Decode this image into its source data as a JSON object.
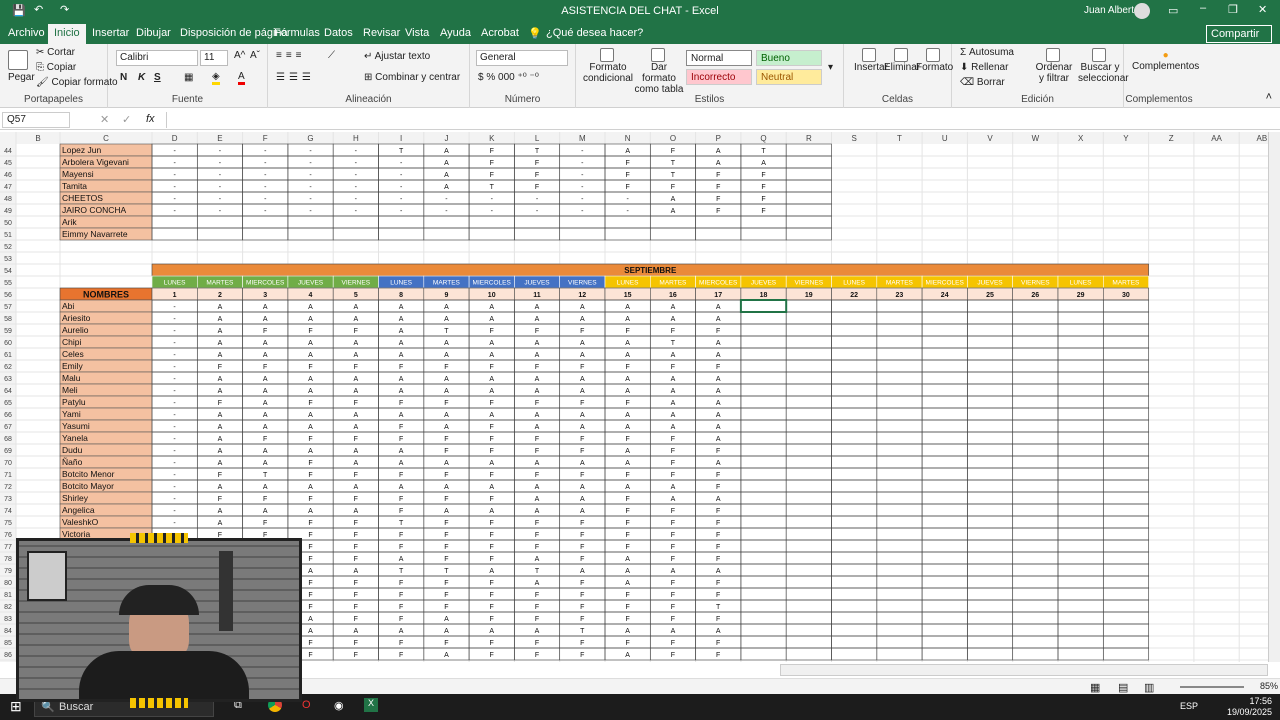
{
  "window": {
    "title": "ASISTENCIA DEL CHAT  -  Excel",
    "user": "Juan Alberto"
  },
  "menu_tabs": [
    "Archivo",
    "Inicio",
    "Insertar",
    "Dibujar",
    "Disposición de página",
    "Fórmulas",
    "Datos",
    "Revisar",
    "Vista",
    "Ayuda",
    "Acrobat"
  ],
  "tell_me": "¿Qué desea hacer?",
  "share_label": "Compartir",
  "ribbon": {
    "clipboard": {
      "paste": "Pegar",
      "cut": "Cortar",
      "copy": "Copiar",
      "format_painter": "Copiar formato",
      "label": "Portapapeles"
    },
    "font": {
      "name": "Calibri",
      "size": "11",
      "label": "Fuente",
      "bold": "N",
      "italic": "K",
      "underline": "S"
    },
    "alignment": {
      "wrap": "Ajustar texto",
      "merge": "Combinar y centrar",
      "label": "Alineación"
    },
    "number": {
      "format": "General",
      "label": "Número"
    },
    "styles": {
      "cond": "Formato condicional",
      "table": "Dar formato como tabla",
      "normal": "Normal",
      "good": "Bueno",
      "bad": "Incorrecto",
      "neutral": "Neutral",
      "label": "Estilos"
    },
    "cells": {
      "insert": "Insertar",
      "delete": "Eliminar",
      "format": "Formato",
      "label": "Celdas"
    },
    "editing": {
      "autosum": "Autosuma",
      "fill": "Rellenar",
      "clear": "Borrar",
      "sort": "Ordenar y filtrar",
      "find": "Buscar y seleccionar",
      "label": "Edición"
    },
    "addins": {
      "btn": "Complementos",
      "label": "Complementos"
    }
  },
  "namebox": "Q57",
  "columns": [
    "B",
    "C",
    "D",
    "E",
    "F",
    "G",
    "H",
    "I",
    "J",
    "K",
    "L",
    "M",
    "N",
    "O",
    "P",
    "Q",
    "R",
    "S",
    "T",
    "U",
    "V",
    "W",
    "X",
    "Y",
    "Z",
    "AA",
    "AB"
  ],
  "upper_rows": [
    {
      "row": "44",
      "name": "Lopez Jun",
      "vals": [
        "-",
        "-",
        "-",
        "-",
        "-",
        "T",
        "A",
        "F",
        "T",
        "-",
        "A",
        "F",
        "A",
        "T"
      ]
    },
    {
      "row": "45",
      "name": "Arbolera Vigevani",
      "vals": [
        "-",
        "-",
        "-",
        "-",
        "-",
        "-",
        "A",
        "F",
        "F",
        "-",
        "F",
        "T",
        "A",
        "A"
      ]
    },
    {
      "row": "46",
      "name": "Mayensi",
      "vals": [
        "-",
        "-",
        "-",
        "-",
        "-",
        "-",
        "A",
        "F",
        "F",
        "-",
        "F",
        "T",
        "F",
        "F"
      ]
    },
    {
      "row": "47",
      "name": "Tamita",
      "vals": [
        "-",
        "-",
        "-",
        "-",
        "-",
        "-",
        "A",
        "T",
        "F",
        "-",
        "F",
        "F",
        "F",
        "F"
      ]
    },
    {
      "row": "48",
      "name": "CHEETOS",
      "vals": [
        "-",
        "-",
        "-",
        "-",
        "-",
        "-",
        "-",
        "-",
        "-",
        "-",
        "-",
        "A",
        "F",
        "F"
      ]
    },
    {
      "row": "49",
      "name": "JAIRO CONCHA",
      "vals": [
        "-",
        "-",
        "-",
        "-",
        "-",
        "-",
        "-",
        "-",
        "-",
        "-",
        "-",
        "A",
        "F",
        "F"
      ]
    },
    {
      "row": "50",
      "name": "Arik",
      "vals": []
    },
    {
      "row": "51",
      "name": "Eimmy Navarrete",
      "vals": []
    }
  ],
  "month": "SEPTIEMBRE",
  "names_header": "NOMBRES",
  "weekdays": [
    "LUNES",
    "MARTES",
    "MIERCOLES",
    "JUEVES",
    "VIERNES",
    "LUNES",
    "MARTES",
    "MIERCOLES",
    "JUEVES",
    "VIERNES",
    "LUNES",
    "MARTES",
    "MIERCOLES",
    "JUEVES",
    "VIERNES",
    "LUNES",
    "MARTES",
    "MIERCOLES",
    "JUEVES",
    "VIERNES",
    "LUNES",
    "MARTES"
  ],
  "days": [
    "1",
    "2",
    "3",
    "4",
    "5",
    "8",
    "9",
    "10",
    "11",
    "12",
    "15",
    "16",
    "17",
    "18",
    "19",
    "22",
    "23",
    "24",
    "25",
    "26",
    "29",
    "30"
  ],
  "lower_rows": [
    {
      "row": "57",
      "name": "Abi",
      "vals": [
        "-",
        "A",
        "A",
        "A",
        "A",
        "A",
        "A",
        "A",
        "A",
        "A",
        "A",
        "A",
        "A"
      ]
    },
    {
      "row": "58",
      "name": "Ariesito",
      "vals": [
        "-",
        "A",
        "A",
        "A",
        "A",
        "A",
        "A",
        "A",
        "A",
        "A",
        "A",
        "A",
        "A"
      ]
    },
    {
      "row": "59",
      "name": "Aurelio",
      "vals": [
        "-",
        "A",
        "F",
        "F",
        "F",
        "A",
        "T",
        "F",
        "F",
        "F",
        "F",
        "F",
        "F"
      ]
    },
    {
      "row": "60",
      "name": "Chipi",
      "vals": [
        "-",
        "A",
        "A",
        "A",
        "A",
        "A",
        "A",
        "A",
        "A",
        "A",
        "A",
        "T",
        "A"
      ]
    },
    {
      "row": "61",
      "name": "Celes",
      "vals": [
        "-",
        "A",
        "A",
        "A",
        "A",
        "A",
        "A",
        "A",
        "A",
        "A",
        "A",
        "A",
        "A"
      ]
    },
    {
      "row": "62",
      "name": "Emily",
      "vals": [
        "-",
        "F",
        "F",
        "F",
        "F",
        "F",
        "F",
        "F",
        "F",
        "F",
        "F",
        "F",
        "F"
      ]
    },
    {
      "row": "63",
      "name": "Malu",
      "vals": [
        "-",
        "A",
        "A",
        "A",
        "A",
        "A",
        "A",
        "A",
        "A",
        "A",
        "A",
        "A",
        "A"
      ]
    },
    {
      "row": "64",
      "name": "Meli",
      "vals": [
        "-",
        "A",
        "A",
        "A",
        "A",
        "A",
        "A",
        "A",
        "A",
        "A",
        "A",
        "A",
        "A"
      ]
    },
    {
      "row": "65",
      "name": "Patylu",
      "vals": [
        "-",
        "F",
        "A",
        "F",
        "F",
        "F",
        "F",
        "F",
        "F",
        "F",
        "F",
        "A",
        "A"
      ]
    },
    {
      "row": "66",
      "name": "Yami",
      "vals": [
        "-",
        "A",
        "A",
        "A",
        "A",
        "A",
        "A",
        "A",
        "A",
        "A",
        "A",
        "A",
        "A"
      ]
    },
    {
      "row": "67",
      "name": "Yasumi",
      "vals": [
        "-",
        "A",
        "A",
        "A",
        "A",
        "F",
        "A",
        "F",
        "A",
        "A",
        "A",
        "A",
        "A"
      ]
    },
    {
      "row": "68",
      "name": "Yanela",
      "vals": [
        "-",
        "A",
        "F",
        "F",
        "F",
        "F",
        "F",
        "F",
        "F",
        "F",
        "F",
        "F",
        "A"
      ]
    },
    {
      "row": "69",
      "name": "Dudu",
      "vals": [
        "-",
        "A",
        "A",
        "A",
        "A",
        "A",
        "F",
        "F",
        "F",
        "F",
        "A",
        "F",
        "F"
      ]
    },
    {
      "row": "70",
      "name": "Ñaño",
      "vals": [
        "-",
        "A",
        "A",
        "F",
        "A",
        "A",
        "A",
        "A",
        "A",
        "A",
        "A",
        "F",
        "A"
      ]
    },
    {
      "row": "71",
      "name": "Botcito Menor",
      "vals": [
        "-",
        "F",
        "T",
        "F",
        "F",
        "F",
        "F",
        "F",
        "F",
        "F",
        "F",
        "F",
        "F"
      ]
    },
    {
      "row": "72",
      "name": "Botcito Mayor",
      "vals": [
        "-",
        "A",
        "A",
        "A",
        "A",
        "A",
        "A",
        "A",
        "A",
        "A",
        "A",
        "A",
        "F"
      ]
    },
    {
      "row": "73",
      "name": "Shirley",
      "vals": [
        "-",
        "F",
        "F",
        "F",
        "F",
        "F",
        "F",
        "F",
        "A",
        "A",
        "F",
        "A",
        "A"
      ]
    },
    {
      "row": "74",
      "name": "Angelica",
      "vals": [
        "-",
        "A",
        "A",
        "A",
        "A",
        "F",
        "A",
        "A",
        "A",
        "A",
        "F",
        "F",
        "F"
      ]
    },
    {
      "row": "75",
      "name": "ValeshkO",
      "vals": [
        "-",
        "A",
        "F",
        "F",
        "F",
        "T",
        "F",
        "F",
        "F",
        "F",
        "F",
        "F",
        "F"
      ]
    },
    {
      "row": "76",
      "name": "Victoria",
      "vals": [
        "-",
        "F",
        "F",
        "F",
        "F",
        "F",
        "F",
        "F",
        "F",
        "F",
        "F",
        "F",
        "F"
      ]
    },
    {
      "row": "77",
      "name": "",
      "vals": [
        "",
        "",
        "",
        "F",
        "F",
        "F",
        "F",
        "F",
        "F",
        "F",
        "F",
        "F",
        "F"
      ]
    },
    {
      "row": "78",
      "name": "",
      "vals": [
        "",
        "",
        "",
        "F",
        "F",
        "A",
        "F",
        "F",
        "A",
        "F",
        "A",
        "F",
        "F"
      ]
    },
    {
      "row": "79",
      "name": "",
      "vals": [
        "",
        "",
        "",
        "A",
        "A",
        "T",
        "T",
        "A",
        "T",
        "A",
        "A",
        "A",
        "A"
      ]
    },
    {
      "row": "80",
      "name": "",
      "vals": [
        "",
        "",
        "",
        "F",
        "F",
        "F",
        "F",
        "F",
        "A",
        "F",
        "A",
        "F",
        "F"
      ]
    },
    {
      "row": "81",
      "name": "",
      "vals": [
        "",
        "",
        "",
        "F",
        "F",
        "F",
        "F",
        "F",
        "F",
        "F",
        "F",
        "F",
        "F"
      ]
    },
    {
      "row": "82",
      "name": "",
      "vals": [
        "",
        "",
        "",
        "F",
        "F",
        "F",
        "F",
        "F",
        "F",
        "F",
        "F",
        "F",
        "T"
      ]
    },
    {
      "row": "83",
      "name": "",
      "vals": [
        "",
        "",
        "",
        "A",
        "F",
        "F",
        "A",
        "F",
        "F",
        "F",
        "F",
        "F",
        "F"
      ]
    },
    {
      "row": "84",
      "name": "",
      "vals": [
        "",
        "",
        "",
        "A",
        "A",
        "A",
        "A",
        "A",
        "A",
        "T",
        "A",
        "A",
        "A"
      ]
    },
    {
      "row": "85",
      "name": "",
      "vals": [
        "",
        "",
        "",
        "F",
        "F",
        "F",
        "F",
        "F",
        "F",
        "F",
        "F",
        "F",
        "F"
      ]
    },
    {
      "row": "86",
      "name": "",
      "vals": [
        "",
        "",
        "",
        "F",
        "F",
        "F",
        "A",
        "F",
        "F",
        "F",
        "A",
        "F",
        "F"
      ]
    }
  ],
  "colors": {
    "excel_green": "#217346",
    "names_orange": "#f4c1a1",
    "names_header": "#e8742f",
    "header_orange": "#ea8a3a",
    "wk_green": "#70ad47",
    "wk_blue": "#4472c4",
    "wk_yellow": "#f5c400",
    "day_bg": "#fce4d6"
  },
  "status": {
    "zoom": "85%",
    "lang": "ESP",
    "time": "17:56",
    "date": "19/09/2025"
  },
  "taskbar": {
    "search": "Buscar"
  }
}
